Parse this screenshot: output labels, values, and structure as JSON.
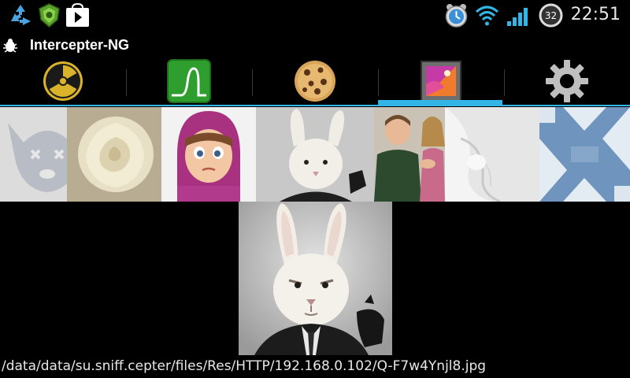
{
  "status_bar": {
    "time": "22:51",
    "battery_level": "32",
    "icons": [
      "recycle-icon",
      "shield-badge-icon",
      "play-store-icon",
      "alarm-clock-icon",
      "wifi-icon",
      "signal-icon",
      "battery-icon"
    ]
  },
  "app": {
    "title": "Intercepter-NG",
    "icon": "bug-icon"
  },
  "tabs": [
    {
      "icon": "radiation-icon",
      "active": false
    },
    {
      "icon": "wireshark-fin-icon",
      "active": false
    },
    {
      "icon": "cookie-icon",
      "active": false
    },
    {
      "icon": "picture-icon",
      "active": true
    },
    {
      "icon": "gear-icon",
      "active": false
    }
  ],
  "thumbnails": [
    "vk-dog-logo",
    "white-rose",
    "cartoon-girl",
    "rabbit-in-suit",
    "two-people-photo",
    "white-fur",
    "blue-pattern"
  ],
  "viewer": {
    "image": "rabbit-in-suit",
    "file_path": "/data/data/su.sniff.cepter/files/Res/HTTP/192.168.0.102/Q-F7w4Ynjl8.jpg"
  },
  "colors": {
    "accent": "#33b5e5",
    "background": "#000000"
  }
}
